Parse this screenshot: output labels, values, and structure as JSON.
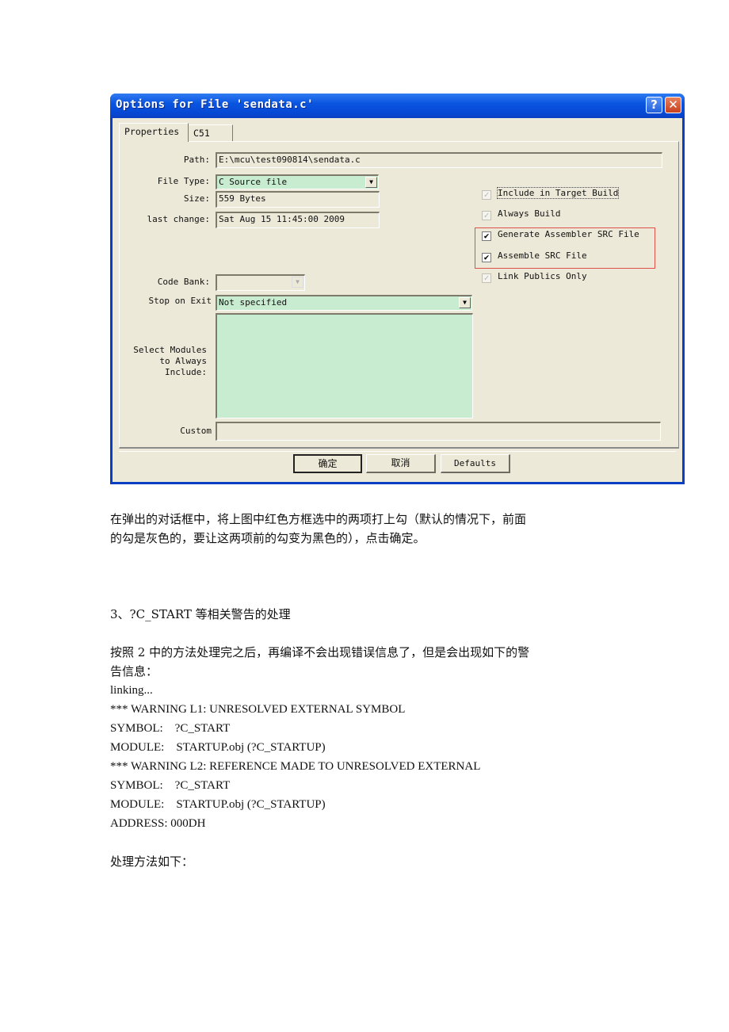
{
  "dialog": {
    "title": "Options for File 'sendata.c'",
    "help_icon": "?",
    "close_icon": "✕",
    "tabs": [
      {
        "label": "Properties",
        "active": true
      },
      {
        "label": "C51",
        "active": false
      }
    ],
    "fields": {
      "path": {
        "label": "Path:",
        "value": "E:\\mcu\\test090814\\sendata.c"
      },
      "file_type": {
        "label": "File Type:",
        "value": "C Source file"
      },
      "size": {
        "label": "Size:",
        "value": "559 Bytes"
      },
      "last_change": {
        "label": "last change:",
        "value": "Sat Aug 15 11:45:00 2009"
      },
      "code_bank": {
        "label": "Code Bank:",
        "value": ""
      },
      "stop_on_exit": {
        "label": "Stop on Exit",
        "value": "Not specified"
      },
      "select_modules": {
        "label": "Select Modules\n  to Always\n   Include:",
        "value": ""
      },
      "custom": {
        "label": "Custom",
        "value": ""
      }
    },
    "checkboxes": [
      {
        "label": "Include in Target Build",
        "checked": true,
        "enabled": false
      },
      {
        "label": "Always Build",
        "checked": true,
        "enabled": false
      },
      {
        "label": "Generate Assembler SRC File",
        "checked": true,
        "enabled": true,
        "highlighted": true
      },
      {
        "label": "Assemble SRC File",
        "checked": true,
        "enabled": true,
        "highlighted": true
      },
      {
        "label": "Link Publics Only",
        "checked": true,
        "enabled": false
      }
    ],
    "buttons": {
      "ok": "确定",
      "cancel": "取消",
      "defaults": "Defaults"
    },
    "colors": {
      "highlight_box": "#e0504a",
      "field_green": "#c8ecd0",
      "dialog_bg": "#ece9d8",
      "titlebar": "#0a55e0"
    }
  },
  "document": {
    "caption_line1": "在弹出的对话框中，将上图中红色方框选中的两项打上勾（默认的情况下，前面",
    "caption_line2": "的勾是灰色的，要让这两项前的勾变为黑色的），点击确定。",
    "section_heading": "3、?C_START 等相关警告的处理",
    "para_line1": "按照 2 中的方法处理完之后，再编译不会出现错误信息了，但是会出现如下的警",
    "para_line2": "告信息：",
    "log_lines": [
      "linking...",
      "*** WARNING L1: UNRESOLVED EXTERNAL SYMBOL",
      "SYMBOL:    ?C_START",
      "MODULE:    STARTUP.obj (?C_STARTUP)",
      "*** WARNING L2: REFERENCE MADE TO UNRESOLVED EXTERNAL",
      "SYMBOL:    ?C_START",
      "MODULE:    STARTUP.obj (?C_STARTUP)",
      "ADDRESS: 000DH"
    ],
    "closing": "处理方法如下："
  }
}
